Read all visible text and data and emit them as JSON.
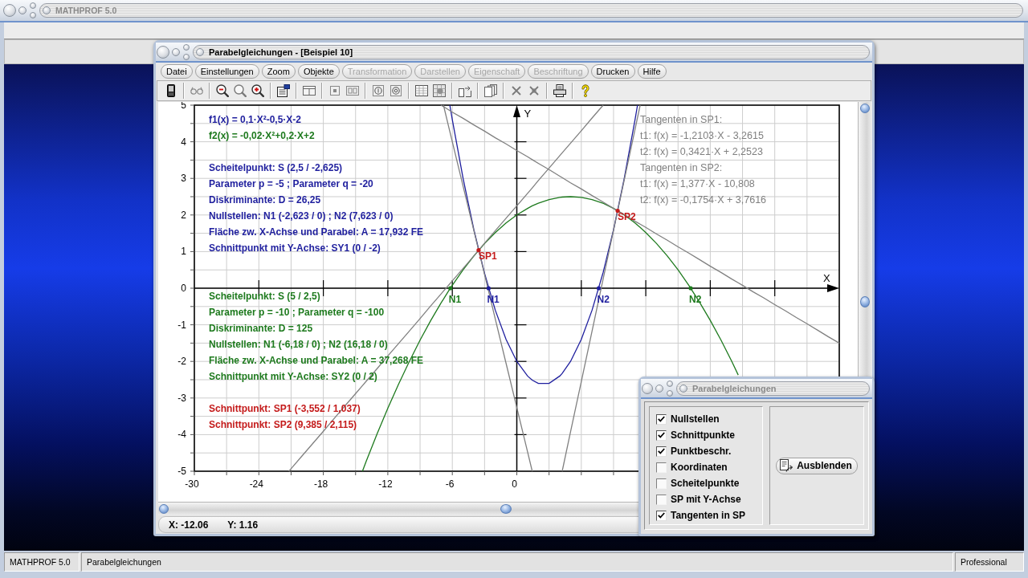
{
  "app_window": {
    "title": "MATHPROF 5.0"
  },
  "document_window": {
    "title": "Parabelgleichungen - [Beispiel 10]",
    "menu": [
      {
        "label": "Datei",
        "disabled": false
      },
      {
        "label": "Einstellungen",
        "disabled": false
      },
      {
        "label": "Zoom",
        "disabled": false
      },
      {
        "label": "Objekte",
        "disabled": false
      },
      {
        "label": "Transformation",
        "disabled": true
      },
      {
        "label": "Darstellen",
        "disabled": true
      },
      {
        "label": "Eigenschaft",
        "disabled": true
      },
      {
        "label": "Beschriftung",
        "disabled": true
      },
      {
        "label": "Drucken",
        "disabled": false
      },
      {
        "label": "Hilfe",
        "disabled": false
      }
    ],
    "plot": {
      "function_notes": [
        {
          "text": "f1(x) = 0,1·X²-0,5·X-2",
          "color": "#1f1f9e"
        },
        {
          "text": "f2(x) = -0,02·X²+0,2·X+2",
          "color": "#1e7a1e"
        }
      ],
      "info_groups": [
        {
          "color": "#1f1f9e",
          "lines": [
            "Scheitelpunkt: S (2,5 / -2,625)",
            "Parameter p = -5 ; Parameter q = -20",
            "Diskriminante: D = 26,25",
            "Nullstellen: N1 (-2,623 / 0) ; N2 (7,623 / 0)",
            "Fläche zw. X-Achse und Parabel: A = 17,932 FE",
            "Schnittpunkt mit Y-Achse: SY1 (0 / -2)"
          ]
        },
        {
          "color": "#1e7a1e",
          "lines": [
            "Scheitelpunkt: S (5 / 2,5)",
            "Parameter p = -10 ; Parameter q = -100",
            "Diskriminante: D = 125",
            "Nullstellen: N1 (-6,18 / 0) ; N2 (16,18 / 0)",
            "Fläche zw. X-Achse und Parabel: A = 37,268 FE",
            "Schnittpunkt mit Y-Achse: SY2 (0 / 2)"
          ]
        },
        {
          "color": "#c41a1a",
          "lines": [
            "Schnittpunkt: SP1 (-3,552 / 1,037)",
            "Schnittpunkt: SP2 (9,385 / 2,115)"
          ]
        }
      ],
      "tangent_notes": {
        "color": "#808080",
        "lines": [
          "Tangenten in SP1:",
          "t1: f(x) = -1,2103·X - 3,2615",
          "t2: f(x) = 0,3421·X + 2,2523",
          "Tangenten in SP2:",
          "t1: f(x) = 1,377·X - 10,808",
          "t2: f(x) = -0,1754·X + 3,7616"
        ]
      },
      "chart_data": {
        "type": "line",
        "xlabel": "X",
        "ylabel": "Y",
        "xlim": [
          -30,
          30
        ],
        "ylim": [
          -5,
          5
        ],
        "xticks": [
          -30,
          -24,
          -18,
          -12,
          -6,
          0
        ],
        "yticks": [
          -5,
          -4,
          -3,
          -2,
          -1,
          0,
          1,
          2,
          3,
          4,
          5
        ],
        "grid": true,
        "x": [
          -21.199,
          -21,
          -20,
          -19,
          -18,
          -17,
          -16,
          -15,
          -14.36,
          -14,
          -13,
          -12,
          -11,
          -10,
          -9,
          -8,
          -7.06,
          -7,
          -6.825,
          -6.23,
          -6,
          -5,
          -4,
          -3,
          -2,
          -1,
          0,
          1,
          1.436,
          2,
          3,
          4,
          4.218,
          5,
          6,
          7,
          8,
          8.03,
          9,
          10,
          11,
          11.23,
          11.479,
          12,
          13,
          14,
          15,
          16,
          17,
          18,
          19,
          20,
          20.6,
          21,
          22,
          23,
          24,
          25,
          26,
          27,
          28,
          29,
          30
        ],
        "series": [
          {
            "color": "#1f1f9e",
            "values": [
              null,
              null,
              null,
              null,
              null,
              null,
              null,
              null,
              null,
              null,
              null,
              null,
              null,
              null,
              null,
              null,
              null,
              null,
              null,
              5,
              4.6,
              3,
              1.6,
              0.4,
              -0.6,
              -1.4,
              -2,
              -2.4,
              -2.51,
              -2.6,
              -2.6,
              -2.4,
              -2.33,
              -2,
              -1.4,
              -0.6,
              0.4,
              0.43,
              1.6,
              3,
              4.6,
              5,
              null,
              null,
              null,
              null,
              null,
              null,
              null,
              null,
              null,
              null,
              null,
              null,
              null,
              null,
              null,
              null,
              null,
              null,
              null,
              null,
              null
            ]
          },
          {
            "color": "#1e7a1e",
            "values": [
              null,
              null,
              null,
              null,
              null,
              null,
              null,
              null,
              -5,
              -4.72,
              -3.98,
              -3.28,
              -2.62,
              -2,
              -1.42,
              -0.88,
              -0.41,
              -0.38,
              -0.3,
              -0.02,
              0.08,
              0.5,
              0.88,
              1.22,
              1.52,
              1.78,
              2,
              2.18,
              2.25,
              2.32,
              2.42,
              2.48,
              2.49,
              2.5,
              2.48,
              2.42,
              2.32,
              2.32,
              2.18,
              2,
              1.78,
              1.72,
              1.66,
              1.52,
              1.22,
              0.88,
              0.5,
              0.08,
              -0.38,
              -0.88,
              -1.42,
              -2,
              -2.37,
              null,
              null,
              null,
              null,
              null,
              null,
              null,
              null,
              null,
              null
            ]
          },
          {
            "color": "#808080",
            "values": [
              null,
              null,
              null,
              null,
              null,
              null,
              null,
              null,
              null,
              null,
              null,
              null,
              null,
              null,
              null,
              null,
              null,
              null,
              5,
              4.28,
              4,
              2.79,
              1.58,
              0.37,
              -0.84,
              -2.05,
              -3.26,
              -4.47,
              -5,
              null,
              null,
              null,
              null,
              null,
              null,
              null,
              null,
              null,
              null,
              null,
              null,
              null,
              null,
              null,
              null,
              null,
              null,
              null,
              null,
              null,
              null,
              null,
              null,
              null,
              null,
              null,
              null,
              null,
              null,
              null,
              null,
              null,
              null
            ]
          },
          {
            "color": "#808080",
            "values": [
              -5,
              -4.93,
              -4.59,
              -4.25,
              -3.91,
              -3.56,
              -3.22,
              -2.88,
              -2.66,
              -2.54,
              -2.2,
              -1.85,
              -1.51,
              -1.17,
              -0.83,
              -0.48,
              -0.16,
              -0.14,
              -0.08,
              0.12,
              0.2,
              0.54,
              0.88,
              1.23,
              1.57,
              1.91,
              2.25,
              2.59,
              2.74,
              2.94,
              3.28,
              3.62,
              3.7,
              3.96,
              4.3,
              4.65,
              4.99,
              5,
              null,
              null,
              null,
              null,
              null,
              null,
              null,
              null,
              null,
              null,
              null,
              null,
              null,
              null,
              null,
              null,
              null,
              null,
              null,
              null,
              null,
              null,
              null,
              null,
              null
            ]
          },
          {
            "color": "#808080",
            "values": [
              null,
              null,
              null,
              null,
              null,
              null,
              null,
              null,
              null,
              null,
              null,
              null,
              null,
              null,
              null,
              null,
              null,
              null,
              null,
              null,
              null,
              null,
              null,
              null,
              null,
              null,
              null,
              null,
              null,
              null,
              null,
              null,
              -5,
              -3.92,
              -2.55,
              -1.17,
              0.21,
              0.25,
              1.59,
              2.96,
              4.34,
              4.66,
              5,
              null,
              null,
              null,
              null,
              null,
              null,
              null,
              null,
              null,
              null,
              null,
              null,
              null,
              null,
              null,
              null,
              null,
              null,
              null,
              null
            ]
          },
          {
            "color": "#808080",
            "values": [
              null,
              null,
              null,
              null,
              null,
              null,
              null,
              null,
              null,
              null,
              null,
              null,
              null,
              null,
              null,
              null,
              5,
              4.99,
              4.96,
              4.85,
              4.81,
              4.64,
              4.46,
              4.29,
              4.11,
              3.94,
              3.76,
              3.59,
              3.51,
              3.41,
              3.24,
              3.06,
              3.02,
              2.88,
              2.71,
              2.53,
              2.36,
              2.35,
              2.18,
              2.01,
              1.83,
              1.79,
              1.75,
              1.66,
              1.48,
              1.31,
              1.13,
              0.96,
              0.78,
              0.6,
              0.43,
              0.25,
              0.15,
              0.08,
              -0.1,
              -0.27,
              -0.45,
              -0.62,
              -0.8,
              -0.97,
              -1.15,
              -1.33,
              -1.5
            ]
          }
        ],
        "annotations": [
          {
            "text": "N1",
            "x": -6.18,
            "y": 0
          },
          {
            "text": "SP1",
            "x": -3.552,
            "y": 1.037
          },
          {
            "text": "N1",
            "x": -2.623,
            "y": 0
          },
          {
            "text": "N2",
            "x": 7.623,
            "y": 0
          },
          {
            "text": "SP2",
            "x": 9.385,
            "y": 2.115
          },
          {
            "text": "N2",
            "x": 16.18,
            "y": 0
          }
        ]
      }
    },
    "status": [
      "X: -12.06",
      "Y: 1.16"
    ]
  },
  "options_dialog": {
    "title": "Parabelgleichungen",
    "options": [
      {
        "label": "Nullstellen",
        "checked": true
      },
      {
        "label": "Schnittpunkte",
        "checked": true
      },
      {
        "label": "Punktbeschr.",
        "checked": true
      },
      {
        "label": "Koordinaten",
        "checked": false
      },
      {
        "label": "Scheitelpunkte",
        "checked": false
      },
      {
        "label": "SP mit Y-Achse",
        "checked": false
      },
      {
        "label": "Tangenten in SP",
        "checked": true
      }
    ],
    "button": "Ausblenden"
  },
  "status_bar": [
    "MATHPROF 5.0",
    "Parabelgleichungen",
    "Professional"
  ]
}
